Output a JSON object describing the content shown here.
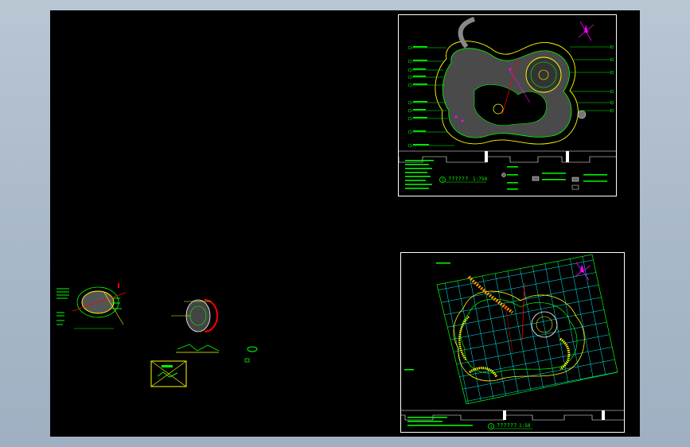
{
  "colors": {
    "background": "#000000",
    "frame": "#ffffff",
    "primary_lines": "#00ff00",
    "secondary_lines": "#ffff00",
    "grid": "#00ffff",
    "accent": "#ff0000",
    "highlight": "#ff00ff"
  },
  "top_sheet": {
    "caption": "??????",
    "scale": "1:750",
    "callout_number": "1"
  },
  "bottom_sheet": {
    "caption": "??????",
    "scale": "1:50",
    "callout_number": "1"
  },
  "icons": [
    "north-arrow-icon",
    "north-arrow-icon"
  ]
}
